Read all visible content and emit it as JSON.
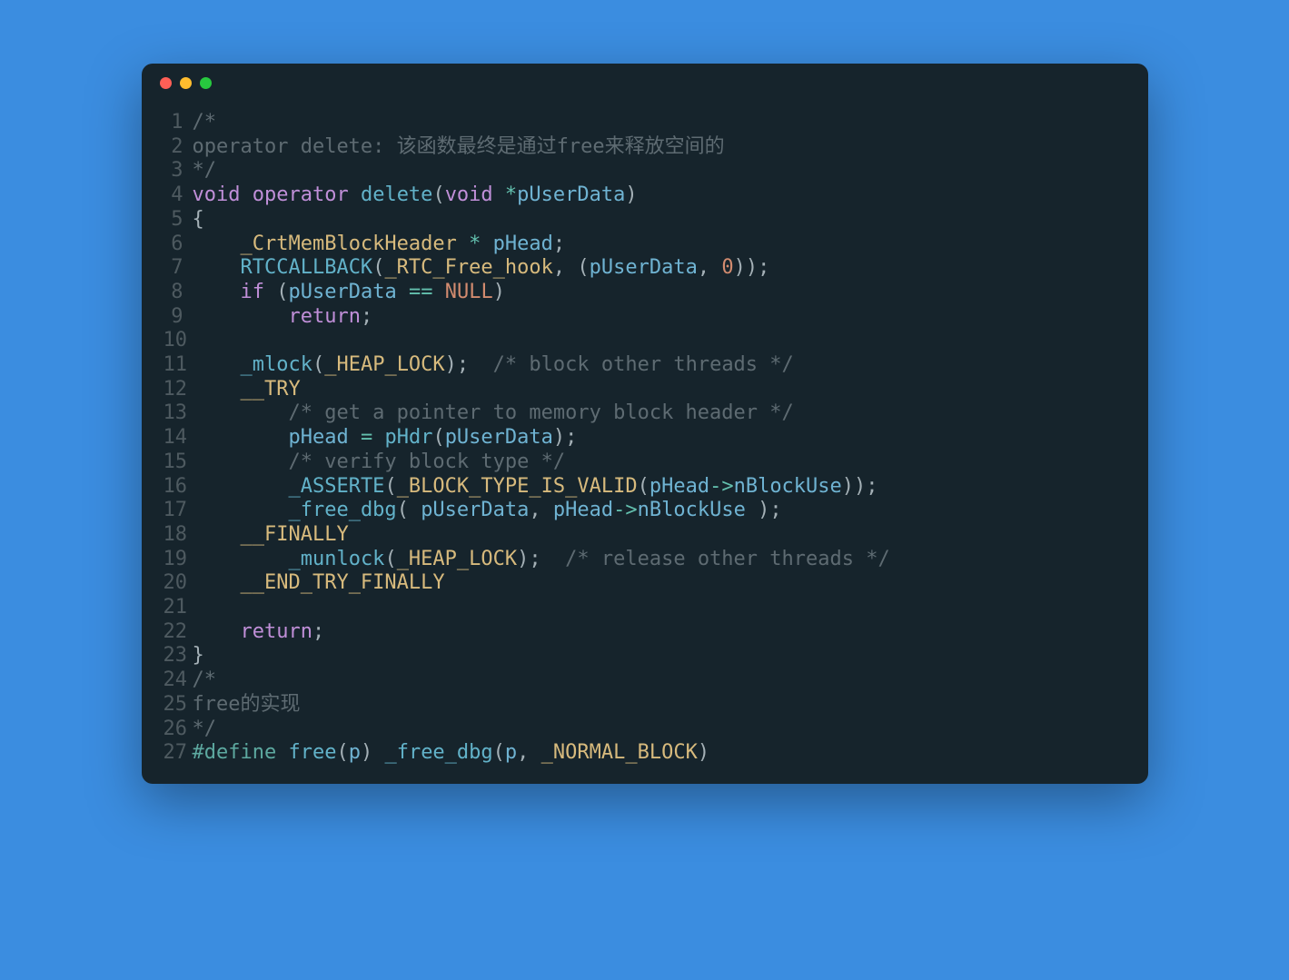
{
  "window": {
    "traffic_lights": [
      "red",
      "yellow",
      "green"
    ]
  },
  "colors": {
    "page_bg": "#3b8de0",
    "editor_bg": "#16242c",
    "gutter": "#4e5a60",
    "comment": "#5e6b72",
    "keyword": "#c08fd8",
    "function": "#62b2c9",
    "identifier": "#d7ba7d",
    "param": "#6fb3d2",
    "constant": "#d28b6f",
    "punct": "#a4b0b6",
    "operator": "#63c0ae",
    "preproc": "#5da9a0"
  },
  "code_lines": [
    {
      "n": 1,
      "tokens": [
        {
          "t": "/*",
          "c": "comment"
        }
      ]
    },
    {
      "n": 2,
      "tokens": [
        {
          "t": "operator delete: 该函数最终是通过free来释放空间的",
          "c": "comment"
        }
      ]
    },
    {
      "n": 3,
      "tokens": [
        {
          "t": "*/",
          "c": "comment"
        }
      ]
    },
    {
      "n": 4,
      "tokens": [
        {
          "t": "void",
          "c": "kw"
        },
        {
          "t": " ",
          "c": "punc"
        },
        {
          "t": "operator",
          "c": "kw"
        },
        {
          "t": " ",
          "c": "punc"
        },
        {
          "t": "delete",
          "c": "fn"
        },
        {
          "t": "(",
          "c": "punc"
        },
        {
          "t": "void",
          "c": "kw"
        },
        {
          "t": " ",
          "c": "punc"
        },
        {
          "t": "*",
          "c": "op"
        },
        {
          "t": "pUserData",
          "c": "param"
        },
        {
          "t": ")",
          "c": "punc"
        }
      ]
    },
    {
      "n": 5,
      "tokens": [
        {
          "t": "{",
          "c": "punc"
        }
      ]
    },
    {
      "n": 6,
      "tokens": [
        {
          "t": "    ",
          "c": "punc"
        },
        {
          "t": "_CrtMemBlockHeader",
          "c": "ident"
        },
        {
          "t": " ",
          "c": "punc"
        },
        {
          "t": "*",
          "c": "op"
        },
        {
          "t": " ",
          "c": "punc"
        },
        {
          "t": "pHead",
          "c": "param"
        },
        {
          "t": ";",
          "c": "punc"
        }
      ]
    },
    {
      "n": 7,
      "tokens": [
        {
          "t": "    ",
          "c": "punc"
        },
        {
          "t": "RTCCALLBACK",
          "c": "fn"
        },
        {
          "t": "(",
          "c": "punc"
        },
        {
          "t": "_RTC_Free_hook",
          "c": "ident"
        },
        {
          "t": ", (",
          "c": "punc"
        },
        {
          "t": "pUserData",
          "c": "param"
        },
        {
          "t": ", ",
          "c": "punc"
        },
        {
          "t": "0",
          "c": "const"
        },
        {
          "t": "));",
          "c": "punc"
        }
      ]
    },
    {
      "n": 8,
      "tokens": [
        {
          "t": "    ",
          "c": "punc"
        },
        {
          "t": "if",
          "c": "kw"
        },
        {
          "t": " (",
          "c": "punc"
        },
        {
          "t": "pUserData",
          "c": "param"
        },
        {
          "t": " ",
          "c": "punc"
        },
        {
          "t": "==",
          "c": "op"
        },
        {
          "t": " ",
          "c": "punc"
        },
        {
          "t": "NULL",
          "c": "const"
        },
        {
          "t": ")",
          "c": "punc"
        }
      ]
    },
    {
      "n": 9,
      "tokens": [
        {
          "t": "        ",
          "c": "punc"
        },
        {
          "t": "return",
          "c": "kw"
        },
        {
          "t": ";",
          "c": "punc"
        }
      ]
    },
    {
      "n": 10,
      "tokens": [
        {
          "t": "",
          "c": "punc"
        }
      ]
    },
    {
      "n": 11,
      "tokens": [
        {
          "t": "    ",
          "c": "punc"
        },
        {
          "t": "_mlock",
          "c": "fn"
        },
        {
          "t": "(",
          "c": "punc"
        },
        {
          "t": "_HEAP_LOCK",
          "c": "ident"
        },
        {
          "t": ");  ",
          "c": "punc"
        },
        {
          "t": "/* block other threads */",
          "c": "comment"
        }
      ]
    },
    {
      "n": 12,
      "tokens": [
        {
          "t": "    ",
          "c": "punc"
        },
        {
          "t": "__TRY",
          "c": "ident"
        }
      ]
    },
    {
      "n": 13,
      "tokens": [
        {
          "t": "        ",
          "c": "punc"
        },
        {
          "t": "/* get a pointer to memory block header */",
          "c": "comment"
        }
      ]
    },
    {
      "n": 14,
      "tokens": [
        {
          "t": "        ",
          "c": "punc"
        },
        {
          "t": "pHead",
          "c": "param"
        },
        {
          "t": " ",
          "c": "punc"
        },
        {
          "t": "=",
          "c": "op"
        },
        {
          "t": " ",
          "c": "punc"
        },
        {
          "t": "pHdr",
          "c": "fn"
        },
        {
          "t": "(",
          "c": "punc"
        },
        {
          "t": "pUserData",
          "c": "param"
        },
        {
          "t": ");",
          "c": "punc"
        }
      ]
    },
    {
      "n": 15,
      "tokens": [
        {
          "t": "        ",
          "c": "punc"
        },
        {
          "t": "/* verify block type */",
          "c": "comment"
        }
      ]
    },
    {
      "n": 16,
      "tokens": [
        {
          "t": "        ",
          "c": "punc"
        },
        {
          "t": "_ASSERTE",
          "c": "fn"
        },
        {
          "t": "(",
          "c": "punc"
        },
        {
          "t": "_BLOCK_TYPE_IS_VALID",
          "c": "ident"
        },
        {
          "t": "(",
          "c": "punc"
        },
        {
          "t": "pHead",
          "c": "param"
        },
        {
          "t": "->",
          "c": "op"
        },
        {
          "t": "nBlockUse",
          "c": "param"
        },
        {
          "t": "));",
          "c": "punc"
        }
      ]
    },
    {
      "n": 17,
      "tokens": [
        {
          "t": "        ",
          "c": "punc"
        },
        {
          "t": "_free_dbg",
          "c": "fn"
        },
        {
          "t": "( ",
          "c": "punc"
        },
        {
          "t": "pUserData",
          "c": "param"
        },
        {
          "t": ", ",
          "c": "punc"
        },
        {
          "t": "pHead",
          "c": "param"
        },
        {
          "t": "->",
          "c": "op"
        },
        {
          "t": "nBlockUse",
          "c": "param"
        },
        {
          "t": " );",
          "c": "punc"
        }
      ]
    },
    {
      "n": 18,
      "tokens": [
        {
          "t": "    ",
          "c": "punc"
        },
        {
          "t": "__FINALLY",
          "c": "ident"
        }
      ]
    },
    {
      "n": 19,
      "tokens": [
        {
          "t": "        ",
          "c": "punc"
        },
        {
          "t": "_munlock",
          "c": "fn"
        },
        {
          "t": "(",
          "c": "punc"
        },
        {
          "t": "_HEAP_LOCK",
          "c": "ident"
        },
        {
          "t": ");  ",
          "c": "punc"
        },
        {
          "t": "/* release other threads */",
          "c": "comment"
        }
      ]
    },
    {
      "n": 20,
      "tokens": [
        {
          "t": "    ",
          "c": "punc"
        },
        {
          "t": "__END_TRY_FINALLY",
          "c": "ident"
        }
      ]
    },
    {
      "n": 21,
      "tokens": [
        {
          "t": "",
          "c": "punc"
        }
      ]
    },
    {
      "n": 22,
      "tokens": [
        {
          "t": "    ",
          "c": "punc"
        },
        {
          "t": "return",
          "c": "kw"
        },
        {
          "t": ";",
          "c": "punc"
        }
      ]
    },
    {
      "n": 23,
      "tokens": [
        {
          "t": "}",
          "c": "punc"
        }
      ]
    },
    {
      "n": 24,
      "tokens": [
        {
          "t": "/*",
          "c": "comment"
        }
      ]
    },
    {
      "n": 25,
      "tokens": [
        {
          "t": "free的实现",
          "c": "comment"
        }
      ]
    },
    {
      "n": 26,
      "tokens": [
        {
          "t": "*/",
          "c": "comment"
        }
      ]
    },
    {
      "n": 27,
      "tokens": [
        {
          "t": "#define",
          "c": "def"
        },
        {
          "t": " ",
          "c": "punc"
        },
        {
          "t": "free",
          "c": "fn"
        },
        {
          "t": "(",
          "c": "punc"
        },
        {
          "t": "p",
          "c": "param"
        },
        {
          "t": ") ",
          "c": "punc"
        },
        {
          "t": "_free_dbg",
          "c": "fn"
        },
        {
          "t": "(",
          "c": "punc"
        },
        {
          "t": "p",
          "c": "param"
        },
        {
          "t": ", ",
          "c": "punc"
        },
        {
          "t": "_NORMAL_BLOCK",
          "c": "ident"
        },
        {
          "t": ")",
          "c": "punc"
        }
      ]
    }
  ]
}
